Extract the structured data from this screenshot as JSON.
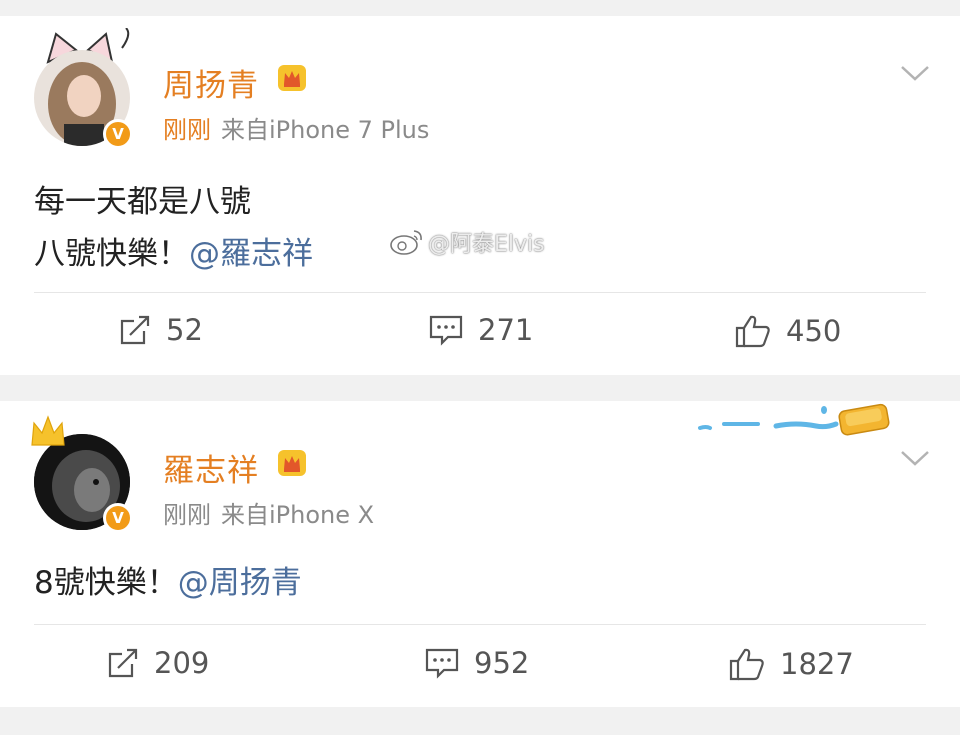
{
  "posts": [
    {
      "username": "周扬青",
      "time": "刚刚",
      "source": "来自iPhone 7 Plus",
      "content_line1": "每一天都是八號",
      "content_line2_text": "八號快樂！",
      "content_line2_mention": "@羅志祥",
      "repost_count": "52",
      "comment_count": "271",
      "like_count": "450"
    },
    {
      "username": "羅志祥",
      "time": "刚刚",
      "source": "来自iPhone X",
      "content_text": "8號快樂！",
      "content_mention": "@周扬青",
      "repost_count": "209",
      "comment_count": "952",
      "like_count": "1827"
    }
  ],
  "watermark": "@阿泰Elvis",
  "verified_badge_letter": "V",
  "colors": {
    "username": "#e47f22",
    "mention": "#4c6e9c",
    "verified": "#f29b18"
  }
}
